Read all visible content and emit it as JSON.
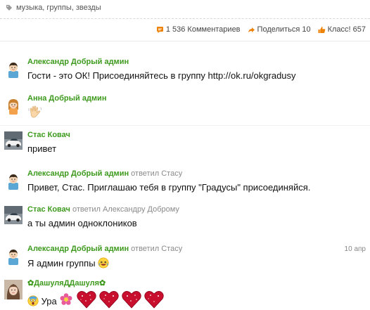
{
  "tags": {
    "text": "музыка, группы, звезды",
    "icon": "tag-icon"
  },
  "stats": {
    "comments": "1 536 Комментариев",
    "share": "Поделиться 10",
    "likes": "Класс! 657"
  },
  "comments": [
    {
      "author": "Александр Добрый админ",
      "text": "Гости - это ОК! Присоединяйтесь в группу http://ok.ru/okgradusy",
      "avatar": "male-avatar-icon"
    },
    {
      "author": "Анна Добрый админ",
      "text": "",
      "avatar": "female-avatar-icon",
      "emoji": "waving-hand-icon"
    },
    {
      "author": "Стас Ковач",
      "text": "привет",
      "avatar": "car-photo-avatar"
    },
    {
      "author": "Александр Добрый админ",
      "reply_verb": "ответил",
      "reply_to": "Стасу",
      "text": "Привет, Стас. Приглашаю тебя в группу \"Градусы\" присоединяйся.",
      "avatar": "male-avatar-icon"
    },
    {
      "author": "Стас Ковач",
      "reply_verb": "ответил",
      "reply_to": "Александру Доброму",
      "text": "а ты админ одноклоников",
      "avatar": "car-photo-avatar"
    },
    {
      "author": "Александр Добрый админ",
      "reply_verb": "ответил",
      "reply_to": "Стасу",
      "date": "10 апр",
      "text": "Я админ группы",
      "avatar": "male-avatar-icon",
      "emoji": "laughing-face-icon"
    },
    {
      "author": "✿ДашуляДДашуля✿",
      "text": "Ура",
      "avatar": "girl-photo-avatar",
      "emojis": [
        "shocked-face-icon",
        "flower-icon",
        "sparkle-heart-icon",
        "sparkle-heart-icon",
        "sparkle-heart-icon",
        "sparkle-heart-icon"
      ]
    }
  ],
  "colors": {
    "author": "#3d9a1d",
    "accent": "#ee8208",
    "meta": "#8a8a8a"
  }
}
